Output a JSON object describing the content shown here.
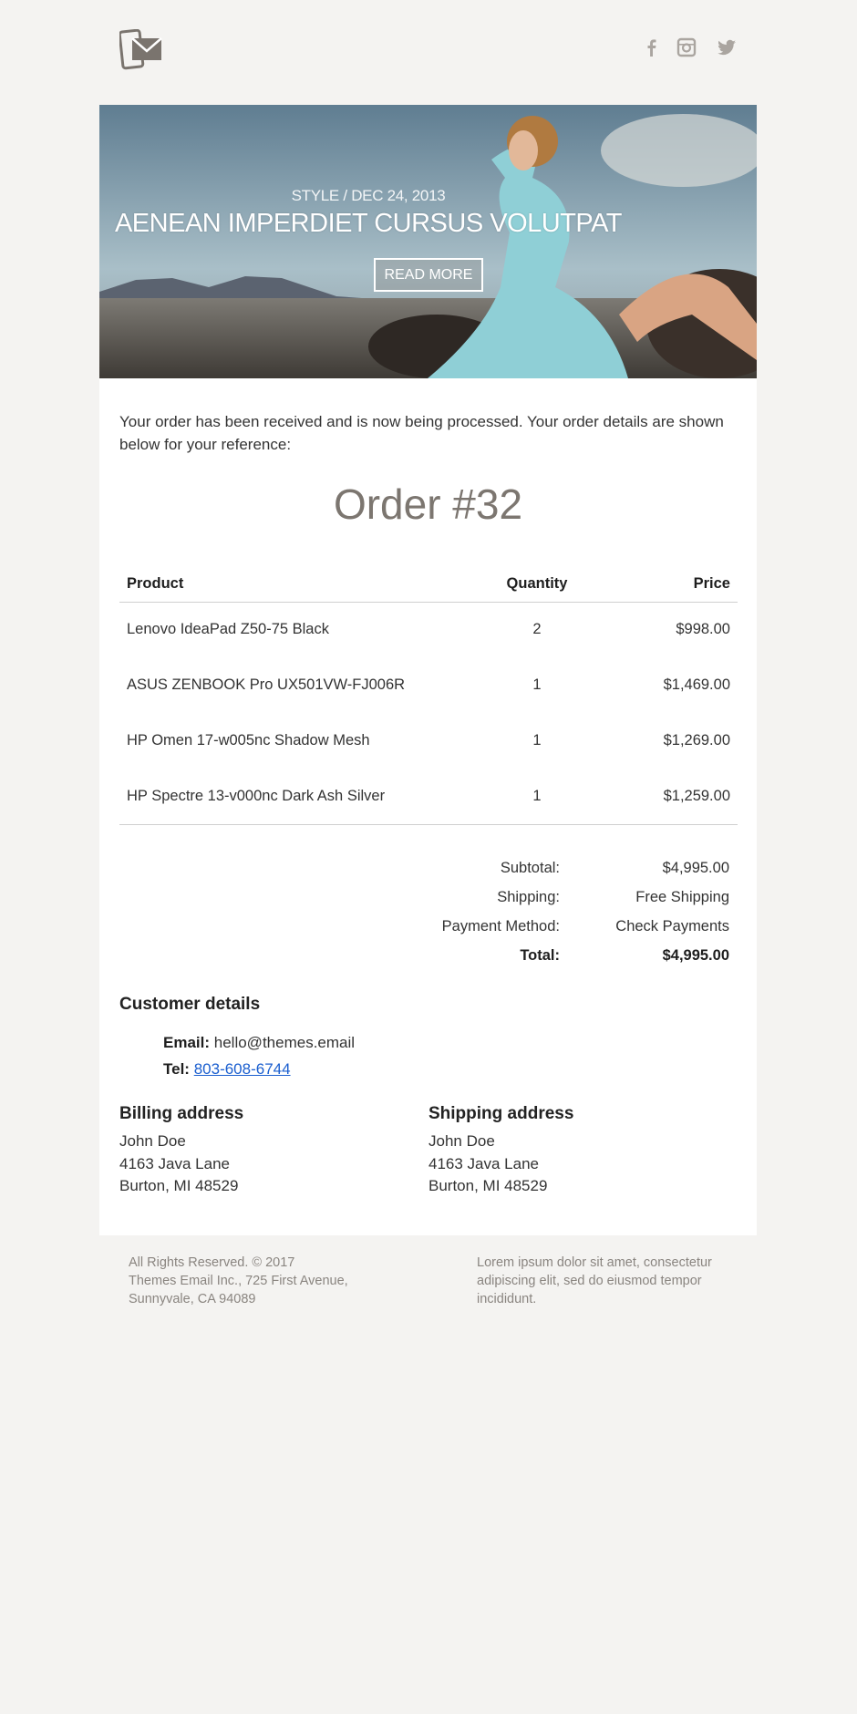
{
  "header": {
    "logo": "themes-email-logo",
    "social": [
      "facebook-icon",
      "instagram-icon",
      "twitter-icon"
    ]
  },
  "hero": {
    "meta": "STYLE / DEC 24, 2013",
    "title": "AENEAN IMPERDIET CURSUS VOLUTPAT",
    "button": "READ MORE"
  },
  "intro": "Your order has been received and is now being processed. Your order details are shown below for your reference:",
  "order_title": "Order #32",
  "table": {
    "headers": [
      "Product",
      "Quantity",
      "Price"
    ],
    "rows": [
      {
        "product": "Lenovo IdeaPad Z50-75 Black",
        "quantity": "2",
        "price": "$998.00"
      },
      {
        "product": "ASUS ZENBOOK Pro UX501VW-FJ006R",
        "quantity": "1",
        "price": "$1,469.00"
      },
      {
        "product": "HP Omen 17-w005nc Shadow Mesh",
        "quantity": "1",
        "price": "$1,269.00"
      },
      {
        "product": "HP Spectre 13-v000nc Dark Ash Silver",
        "quantity": "1",
        "price": "$1,259.00"
      }
    ]
  },
  "totals": [
    {
      "label": "Subtotal:",
      "value": "$4,995.00"
    },
    {
      "label": "Shipping:",
      "value": "Free Shipping"
    },
    {
      "label": "Payment Method:",
      "value": "Check Payments"
    },
    {
      "label": "Total:",
      "value": "$4,995.00"
    }
  ],
  "customer": {
    "title": "Customer details",
    "email_label": "Email:",
    "email": "hello@themes.email",
    "tel_label": "Tel:",
    "tel": "803-608-6744"
  },
  "billing": {
    "title": "Billing address",
    "lines": [
      "John Doe",
      "4163 Java Lane",
      "Burton, MI 48529"
    ]
  },
  "shipping": {
    "title": "Shipping address",
    "lines": [
      "John Doe",
      "4163 Java Lane",
      "Burton, MI 48529"
    ]
  },
  "footer": {
    "left": [
      "All Rights Reserved. © 2017",
      "Themes Email Inc., 725 First Avenue,",
      "Sunnyvale, CA 94089"
    ],
    "right": [
      "Lorem ipsum dolor sit amet, consectetur",
      "adipiscing elit, sed do eiusmod tempor",
      "incididunt."
    ]
  },
  "colors": {
    "background": "#f4f3f1",
    "accent": "#7c7670",
    "link": "#1a5ecf"
  }
}
